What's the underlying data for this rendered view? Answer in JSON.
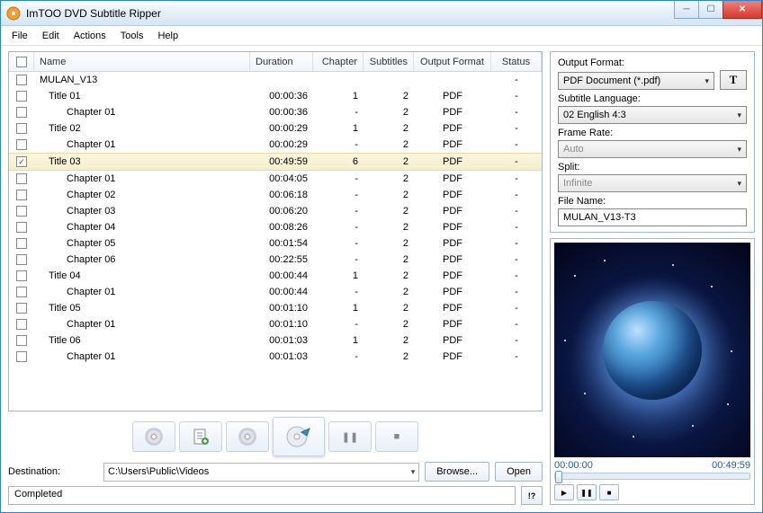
{
  "window": {
    "title": "ImTOO DVD Subtitle Ripper"
  },
  "menu": {
    "file": "File",
    "edit": "Edit",
    "actions": "Actions",
    "tools": "Tools",
    "help": "Help"
  },
  "table": {
    "headers": {
      "name": "Name",
      "duration": "Duration",
      "chapter": "Chapter",
      "subtitles": "Subtitles",
      "format": "Output Format",
      "status": "Status"
    },
    "rows": [
      {
        "checked": false,
        "indent": 0,
        "name": "MULAN_V13",
        "duration": "",
        "chapter": "",
        "subtitles": "",
        "format": "",
        "status": "-",
        "selected": false
      },
      {
        "checked": false,
        "indent": 1,
        "name": "Title 01",
        "duration": "00:00:36",
        "chapter": "1",
        "subtitles": "2",
        "format": "PDF",
        "status": "-",
        "selected": false
      },
      {
        "checked": false,
        "indent": 2,
        "name": "Chapter 01",
        "duration": "00:00:36",
        "chapter": "-",
        "subtitles": "2",
        "format": "PDF",
        "status": "-",
        "selected": false
      },
      {
        "checked": false,
        "indent": 1,
        "name": "Title 02",
        "duration": "00:00:29",
        "chapter": "1",
        "subtitles": "2",
        "format": "PDF",
        "status": "-",
        "selected": false
      },
      {
        "checked": false,
        "indent": 2,
        "name": "Chapter 01",
        "duration": "00:00:29",
        "chapter": "-",
        "subtitles": "2",
        "format": "PDF",
        "status": "-",
        "selected": false
      },
      {
        "checked": true,
        "indent": 1,
        "name": "Title 03",
        "duration": "00:49:59",
        "chapter": "6",
        "subtitles": "2",
        "format": "PDF",
        "status": "-",
        "selected": true
      },
      {
        "checked": false,
        "indent": 2,
        "name": "Chapter 01",
        "duration": "00:04:05",
        "chapter": "-",
        "subtitles": "2",
        "format": "PDF",
        "status": "-",
        "selected": false
      },
      {
        "checked": false,
        "indent": 2,
        "name": "Chapter 02",
        "duration": "00:06:18",
        "chapter": "-",
        "subtitles": "2",
        "format": "PDF",
        "status": "-",
        "selected": false
      },
      {
        "checked": false,
        "indent": 2,
        "name": "Chapter 03",
        "duration": "00:06:20",
        "chapter": "-",
        "subtitles": "2",
        "format": "PDF",
        "status": "-",
        "selected": false
      },
      {
        "checked": false,
        "indent": 2,
        "name": "Chapter 04",
        "duration": "00:08:26",
        "chapter": "-",
        "subtitles": "2",
        "format": "PDF",
        "status": "-",
        "selected": false
      },
      {
        "checked": false,
        "indent": 2,
        "name": "Chapter 05",
        "duration": "00:01:54",
        "chapter": "-",
        "subtitles": "2",
        "format": "PDF",
        "status": "-",
        "selected": false
      },
      {
        "checked": false,
        "indent": 2,
        "name": "Chapter 06",
        "duration": "00:22:55",
        "chapter": "-",
        "subtitles": "2",
        "format": "PDF",
        "status": "-",
        "selected": false
      },
      {
        "checked": false,
        "indent": 1,
        "name": "Title 04",
        "duration": "00:00:44",
        "chapter": "1",
        "subtitles": "2",
        "format": "PDF",
        "status": "-",
        "selected": false
      },
      {
        "checked": false,
        "indent": 2,
        "name": "Chapter 01",
        "duration": "00:00:44",
        "chapter": "-",
        "subtitles": "2",
        "format": "PDF",
        "status": "-",
        "selected": false
      },
      {
        "checked": false,
        "indent": 1,
        "name": "Title 05",
        "duration": "00:01:10",
        "chapter": "1",
        "subtitles": "2",
        "format": "PDF",
        "status": "-",
        "selected": false
      },
      {
        "checked": false,
        "indent": 2,
        "name": "Chapter 01",
        "duration": "00:01:10",
        "chapter": "-",
        "subtitles": "2",
        "format": "PDF",
        "status": "-",
        "selected": false
      },
      {
        "checked": false,
        "indent": 1,
        "name": "Title 06",
        "duration": "00:01:03",
        "chapter": "1",
        "subtitles": "2",
        "format": "PDF",
        "status": "-",
        "selected": false
      },
      {
        "checked": false,
        "indent": 2,
        "name": "Chapter 01",
        "duration": "00:01:03",
        "chapter": "-",
        "subtitles": "2",
        "format": "PDF",
        "status": "-",
        "selected": false
      }
    ]
  },
  "toolbar": {
    "pause": "❚❚",
    "stop": "■"
  },
  "destination": {
    "label": "Destination:",
    "path": "C:\\Users\\Public\\Videos",
    "browse": "Browse...",
    "open": "Open"
  },
  "status": {
    "text": "Completed",
    "info_btn": "!?"
  },
  "props": {
    "output_format": {
      "label": "Output Format:",
      "value": "PDF Document (*.pdf)",
      "t_btn": "T"
    },
    "subtitle_lang": {
      "label": "Subtitle Language:",
      "value": "02 English 4:3"
    },
    "frame_rate": {
      "label": "Frame Rate:",
      "value": "Auto"
    },
    "split": {
      "label": "Split:",
      "value": "Infinite"
    },
    "file_name": {
      "label": "File Name:",
      "value": "MULAN_V13-T3"
    }
  },
  "preview": {
    "time_start": "00:00:00",
    "time_end": "00:49:59",
    "play": "▶",
    "pause": "❚❚",
    "stop": "■"
  }
}
